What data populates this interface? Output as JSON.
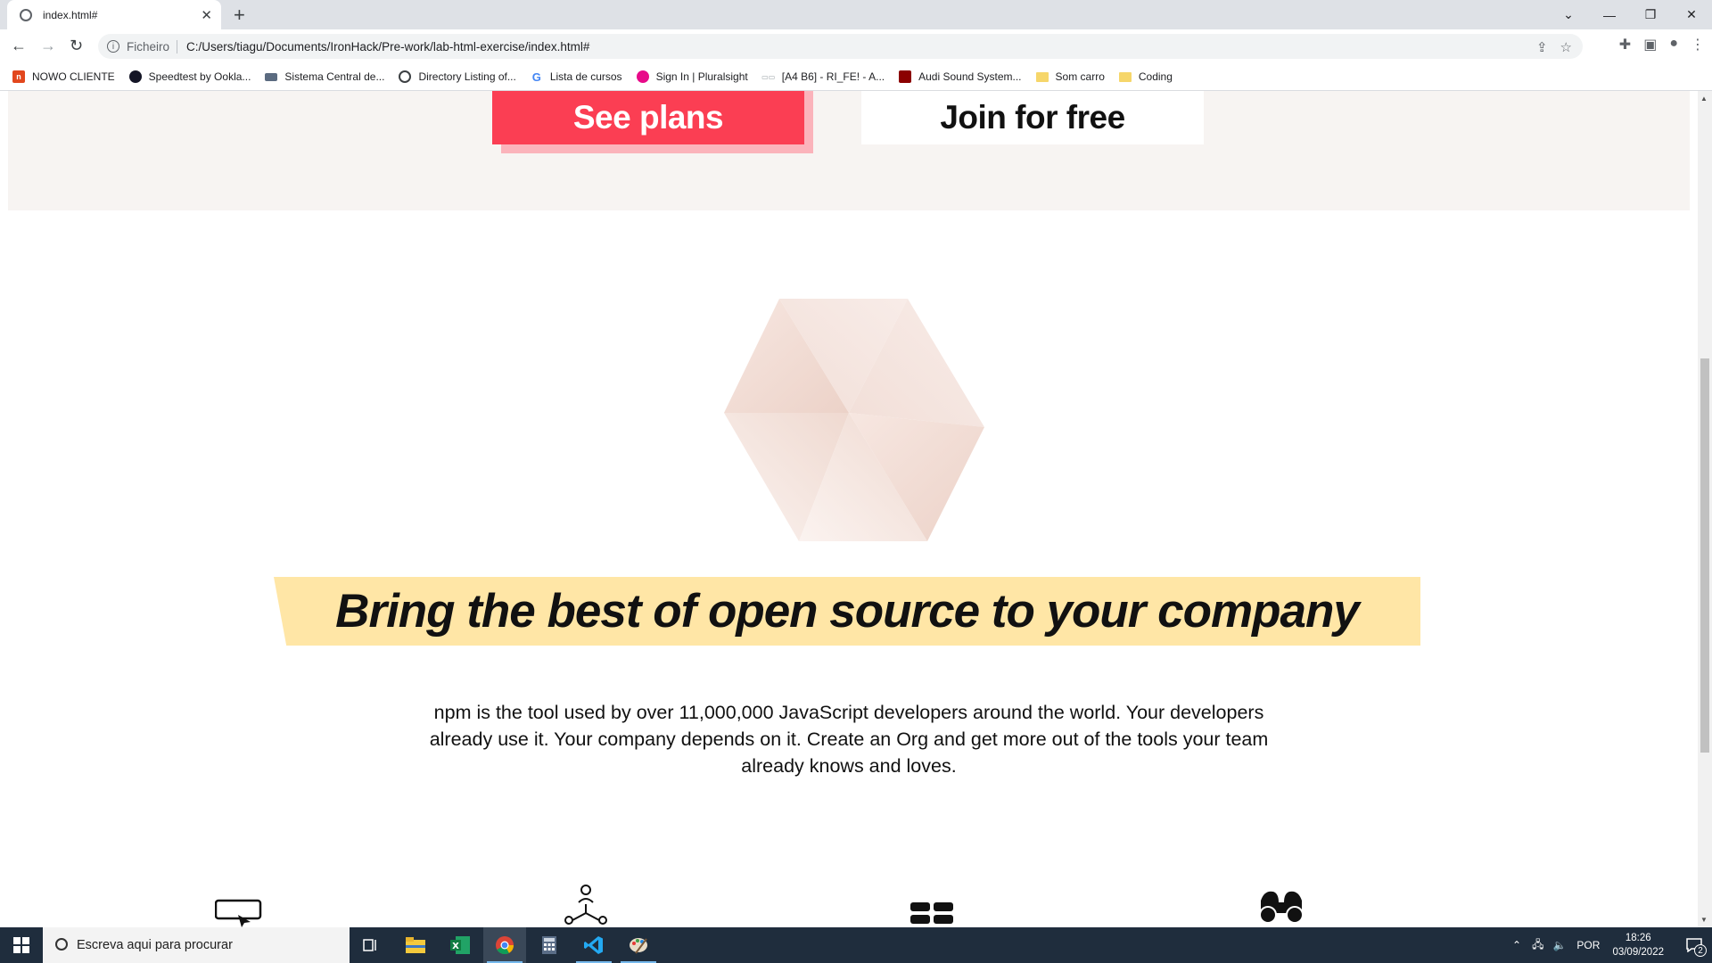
{
  "browser": {
    "tab_title": "index.html#",
    "scheme_label": "Ficheiro",
    "url": "C:/Users/tiagu/Documents/IronHack/Pre-work/lab-html-exercise/index.html#"
  },
  "bookmarks": [
    {
      "label": "NOWO CLIENTE",
      "color": "#e2471d"
    },
    {
      "label": "Speedtest by Ookla...",
      "color": "#141526"
    },
    {
      "label": "Sistema Central de...",
      "color": "#5b6b80"
    },
    {
      "label": "Directory Listing of...",
      "color": "#3c4043"
    },
    {
      "label": "Lista de cursos",
      "color": "#4285f4"
    },
    {
      "label": "Sign In | Pluralsight",
      "color": "#e80a89"
    },
    {
      "label": "[A4 B6] - RI_FE! - A...",
      "color": "#9aa0a6"
    },
    {
      "label": "Audi Sound System...",
      "color": "#8b0000"
    },
    {
      "label": "Som carro",
      "color": "#f6d66a"
    },
    {
      "label": "Coding",
      "color": "#f6d66a"
    }
  ],
  "page": {
    "see_plans": "See plans",
    "join_free": "Join for free",
    "headline": "Bring the best of open source to your company",
    "paragraph": "npm is the tool used by over 11,000,000 JavaScript developers around the world. Your developers already use it. Your company depends on it. Create an Org and get more out of the tools your team already knows and loves."
  },
  "colors": {
    "accent_red": "#fb3e53",
    "accent_shadow": "#fbb3bb",
    "banner_yellow": "#ffe6a6",
    "band_bg": "#f7f4f2"
  },
  "taskbar": {
    "search_placeholder": "Escreva aqui para procurar",
    "language": "POR",
    "time": "18:26",
    "date": "03/09/2022",
    "notifications": "2"
  }
}
